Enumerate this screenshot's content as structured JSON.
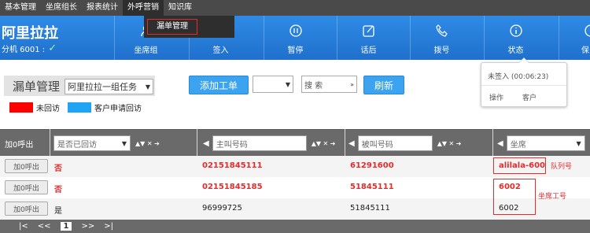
{
  "menubar": {
    "items": [
      "基本管理",
      "坐席组长",
      "报表统计",
      "外呼营销",
      "知识库"
    ]
  },
  "dropdown": {
    "item": "漏单管理"
  },
  "agent": {
    "name": "阿里拉拉",
    "extension": "分机 6001 :"
  },
  "toolbar": {
    "buttons": [
      "坐席组",
      "签入",
      "暂停",
      "话后",
      "拨号",
      "状态",
      "保"
    ]
  },
  "status_popup": {
    "text": "未签入 (00:06:23)",
    "actions": [
      "操作",
      "客户"
    ]
  },
  "page": {
    "title": "漏单管理",
    "task_select": "阿里拉拉一组任务",
    "add_button": "添加工单",
    "search_select": "搜 索",
    "refresh_button": "刷新"
  },
  "legend": [
    {
      "label": "未回访",
      "color": "#ff0000"
    },
    {
      "label": "客户申请回访",
      "color": "#1fa4f4"
    }
  ],
  "table": {
    "first_col_header": "加0呼出",
    "columns": [
      "是否已回访",
      "主叫号码",
      "被叫号码",
      "坐席"
    ],
    "rows": [
      {
        "button": "加0呼出",
        "callback": "否",
        "caller": "02151845111",
        "callee": "61291600",
        "agent": "alilala-600",
        "highlight": true
      },
      {
        "button": "加0呼出",
        "callback": "否",
        "caller": "02151845185",
        "callee": "51845111",
        "agent": "6002",
        "highlight": true
      },
      {
        "button": "加0呼出",
        "callback": "是",
        "caller": "96999725",
        "callee": "51845111",
        "agent": "6002",
        "highlight": false
      }
    ]
  },
  "annotations": {
    "queue": "队列号",
    "agent_id": "坐席工号"
  },
  "pager": {
    "first": "|<",
    "prev": "<<",
    "current": "1",
    "next": ">>",
    "last": ">|"
  }
}
